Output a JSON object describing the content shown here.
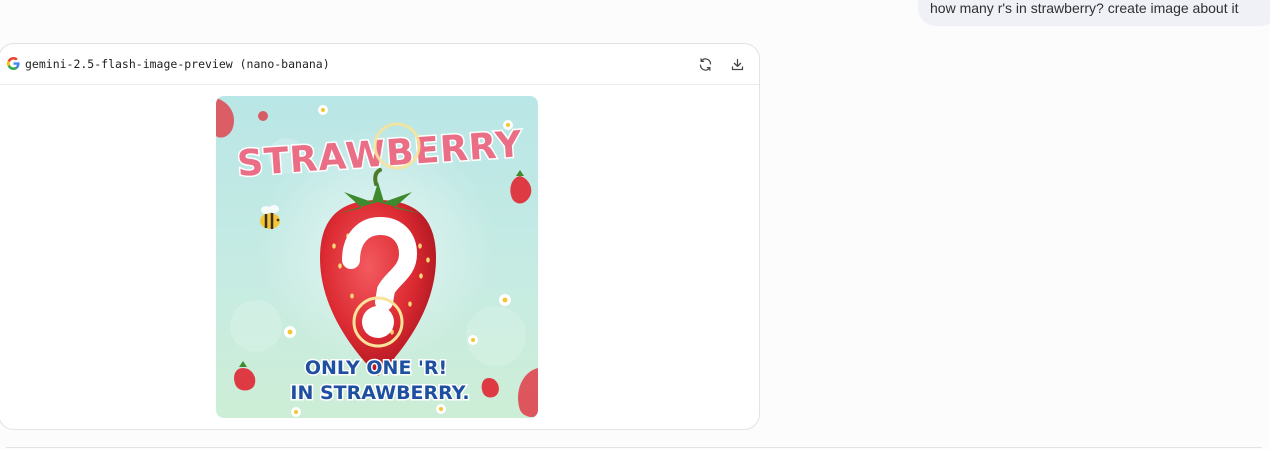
{
  "user_message": {
    "text": "how many r's in strawberry? create image about it"
  },
  "response_card": {
    "model_name": "gemini-2.5-flash-image-preview (nano-banana)",
    "logo_icon": "google-g-icon",
    "actions": [
      {
        "icon": "refresh-icon"
      },
      {
        "icon": "download-icon"
      }
    ],
    "image": {
      "title_text": "STRAWBERRY",
      "caption_line1": "ONLY ONE 'R!",
      "caption_line2": "IN STRAWBERRY."
    }
  },
  "colors": {
    "page_bg": "#fcfcfd",
    "user_bubble_bg": "#f0f1f7",
    "card_border": "#e2e3e7",
    "title_pink": "#ea6f86",
    "caption_blue": "#1e4fa0",
    "berry_red": "#dc2a32"
  }
}
